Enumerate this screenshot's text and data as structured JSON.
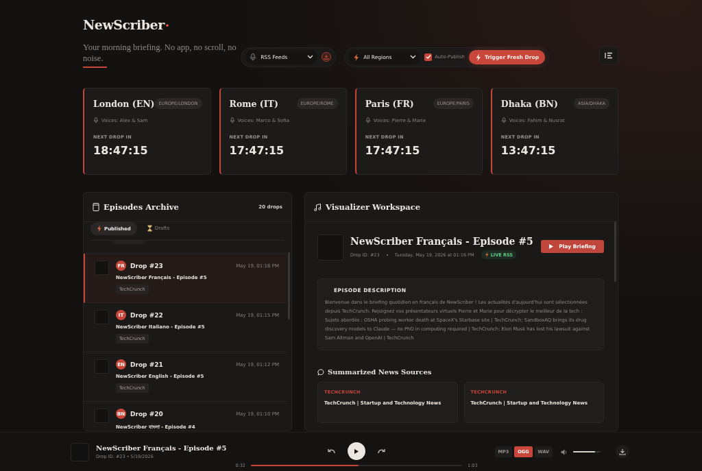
{
  "header": {
    "logo": "NewScriber",
    "tagline": "Your morning briefing. No app, no scroll, no noise.",
    "feed_select": "RSS Feeds",
    "region_select": "All Regions",
    "auto_publish": {
      "label": "Auto-Publish",
      "checked": true
    },
    "trigger_button": "Trigger Fresh Drop"
  },
  "regions": [
    {
      "city": "London (EN)",
      "zone": "EUROPE/LONDON",
      "voices": "Voices: Alex & Sam",
      "next_label": "NEXT DROP IN",
      "countdown": "18:47:15"
    },
    {
      "city": "Rome (IT)",
      "zone": "EUROPE/ROME",
      "voices": "Voices: Marco & Sofia",
      "next_label": "NEXT DROP IN",
      "countdown": "17:47:15"
    },
    {
      "city": "Paris (FR)",
      "zone": "EUROPE/PARIS",
      "voices": "Voices: Pierre & Marie",
      "next_label": "NEXT DROP IN",
      "countdown": "17:47:15"
    },
    {
      "city": "Dhaka (BN)",
      "zone": "ASIA/DHAKA",
      "voices": "Voices: Fahim & Nusrat",
      "next_label": "NEXT DROP IN",
      "countdown": "13:47:15"
    }
  ],
  "archive": {
    "title": "Episodes Archive",
    "count": "20 drops",
    "tabs": [
      {
        "label": "Published",
        "kind": "bolt",
        "selected": true
      },
      {
        "label": "Drafts",
        "kind": "hourglass",
        "selected": false
      }
    ],
    "episodes": [
      {
        "lang": "FR",
        "drop": "Drop #23",
        "date": "May 19, 01:16 PM",
        "title": "NewScriber Français - Episode #5",
        "tag": "TechCrunch",
        "selected": true
      },
      {
        "lang": "IT",
        "drop": "Drop #22",
        "date": "May 19, 01:15 PM",
        "title": "NewScriber Italiano - Episode #5",
        "tag": "TechCrunch",
        "selected": false
      },
      {
        "lang": "EN",
        "drop": "Drop #21",
        "date": "May 19, 01:12 PM",
        "title": "NewScriber English - Episode #5",
        "tag": "TechCrunch",
        "selected": false
      },
      {
        "lang": "BN",
        "drop": "Drop #20",
        "date": "May 19, 01:10 PM",
        "title": "NewScriber বাংলা - Episode #4",
        "selected": false
      }
    ]
  },
  "workspace": {
    "title": "Visualizer Workspace",
    "episode": {
      "title": "NewScriber Français - Episode #5",
      "drop_id": "Drop ID: #23",
      "date": "Tuesday, May 19, 2026 at 01:16 PM",
      "badge": "LIVE RSS",
      "play_button": "Play Briefing"
    },
    "description": {
      "heading": "EPISODE DESCRIPTION",
      "text": "Bienvenue dans le briefing quotidien en français de NewScriber ! Les actualités d'aujourd'hui sont sélectionnées depuis TechCrunch. Rejoignez vos présentateurs virtuels Pierre et Marie pour décrypter le meilleur de la tech : Sujets abordés : OSHA probing worker death at SpaceX's Starbase site | TechCrunch; SandboxAQ brings its drug discovery models to Claude — no PhD in computing required | TechCrunch; Elon Musk has lost his lawsuit against Sam Altman and OpenAI | TechCrunch"
    },
    "sources": {
      "title": "Summarized News Sources",
      "items": [
        {
          "source": "TECHCRUNCH",
          "title": "TechCrunch | Startup and Technology News"
        },
        {
          "source": "TECHCRUNCH",
          "title": "TechCrunch | Startup and Technology News"
        }
      ]
    }
  },
  "player": {
    "title": "NewScriber Français - Episode #5",
    "meta": "Drop ID: #23 • 5/19/2026",
    "elapsed": "0:32",
    "total": "1:03",
    "progress": {
      "level": 0.51
    },
    "formats": [
      {
        "label": "MP3",
        "selected": false
      },
      {
        "label": "OGG",
        "selected": true
      },
      {
        "label": "WAV",
        "selected": false
      }
    ],
    "volume": {
      "level": 0.8
    }
  }
}
